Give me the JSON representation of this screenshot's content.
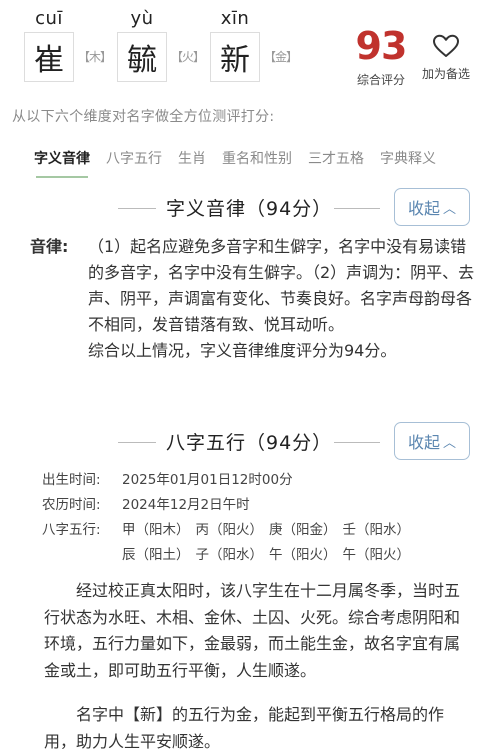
{
  "name": {
    "chars": [
      {
        "pinyin": "cuī",
        "char": "崔",
        "element": "【木】"
      },
      {
        "pinyin": "yù",
        "char": "毓",
        "element": "【火】"
      },
      {
        "pinyin": "xīn",
        "char": "新",
        "element": "【金】"
      }
    ]
  },
  "score": {
    "value": "93",
    "label": "综合评分"
  },
  "favorite": {
    "label": "加为备选",
    "icon": "heart-outline-icon"
  },
  "intro": "从以下六个维度对名字做全方位测评打分:",
  "tabs": [
    {
      "label": "字义音律",
      "active": true
    },
    {
      "label": "八字五行",
      "active": false
    },
    {
      "label": "生肖",
      "active": false
    },
    {
      "label": "重名和性别",
      "active": false
    },
    {
      "label": "三才五格",
      "active": false
    },
    {
      "label": "字典释义",
      "active": false
    }
  ],
  "section1": {
    "title": "字义音律（94分）",
    "collapse_label": "收起",
    "label": "音律:",
    "body": "（1）起名应避免多音字和生僻字，名字中没有易读错的多音字，名字中没有生僻字。（2）声调为：阴平、去声、阴平，声调富有变化、节奏良好。名字声母韵母各不相同，发音错落有致、悦耳动听。",
    "summary": "综合以上情况，字义音律维度评分为94分。"
  },
  "section2": {
    "title": "八字五行（94分）",
    "collapse_label": "收起",
    "birth_label": "出生时间:",
    "birth_value": "2025年01月01日12时00分",
    "lunar_label": "农历时间:",
    "lunar_value": "2024年12月2日午时",
    "bazi_label": "八字五行:",
    "bazi_row1": [
      "甲（阳木）",
      "丙（阳火）",
      "庚（阳金）",
      "壬（阳水）"
    ],
    "bazi_row2": [
      "辰（阳土）",
      "子（阳水）",
      "午（阳火）",
      "午（阳火）"
    ],
    "desc1": "经过校正真太阳时，该八字生在十二月属冬季，当时五行状态为水旺、木相、金休、土囚、火死。综合考虑阴阳和环境，五行力量如下，金最弱，而土能生金，故名字宜有属金或土，即可助五行平衡，人生顺遂。",
    "desc2": "名字中【新】的五行为金，能起到平衡五行格局的作用，助力人生平安顺遂。"
  },
  "colors": {
    "score": "#c0322d",
    "tab_underline": "#a5c8a3",
    "button": "#5b86b0"
  }
}
